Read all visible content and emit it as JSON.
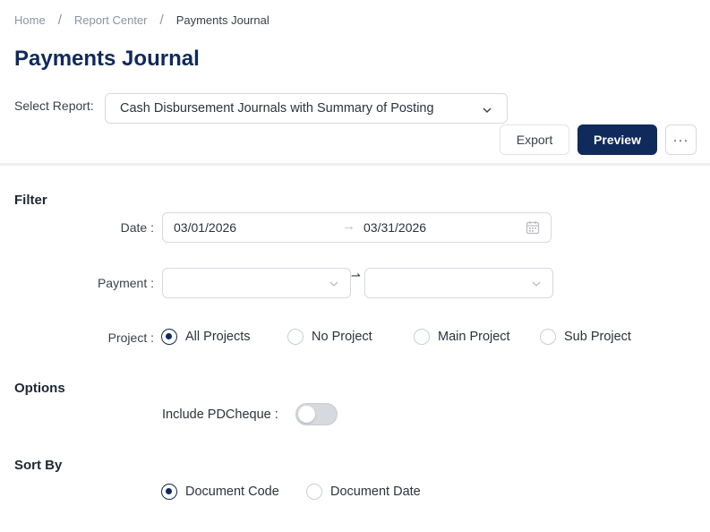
{
  "breadcrumb": {
    "home": "Home",
    "report_center": "Report Center",
    "current": "Payments Journal",
    "separator": "/"
  },
  "page_title": "Payments Journal",
  "report_selector": {
    "label": "Select Report:",
    "value": "Cash Disbursement Journals with Summary of Posting"
  },
  "toolbar": {
    "export_label": "Export",
    "preview_label": "Preview",
    "more_label": "···"
  },
  "filter": {
    "title": "Filter",
    "date_label": "Date :",
    "date_from": "03/01/2026",
    "date_to": "03/31/2026",
    "date_arrow": "→",
    "payment_label": "Payment :",
    "payment_from": "",
    "payment_to": "",
    "payment_arrow": "⇀",
    "project_label": "Project :",
    "project_options": [
      {
        "label": "All Projects",
        "selected": true
      },
      {
        "label": "No Project",
        "selected": false
      },
      {
        "label": "Main Project",
        "selected": false
      },
      {
        "label": "Sub Project",
        "selected": false
      }
    ]
  },
  "options": {
    "title": "Options",
    "pdcheque_label": "Include PDCheque :",
    "pdcheque_enabled": false
  },
  "sort_by": {
    "title": "Sort By",
    "options": [
      {
        "label": "Document Code",
        "selected": true
      },
      {
        "label": "Document Date",
        "selected": false
      }
    ]
  },
  "colors": {
    "brand_navy": "#0f2a5b",
    "border": "#d5d9e0",
    "muted_text": "#8a93a4"
  },
  "icons": {
    "select_chevron": "chevron-down-icon",
    "date_picker": "calendar-icon",
    "more": "more-horizontal-icon"
  }
}
